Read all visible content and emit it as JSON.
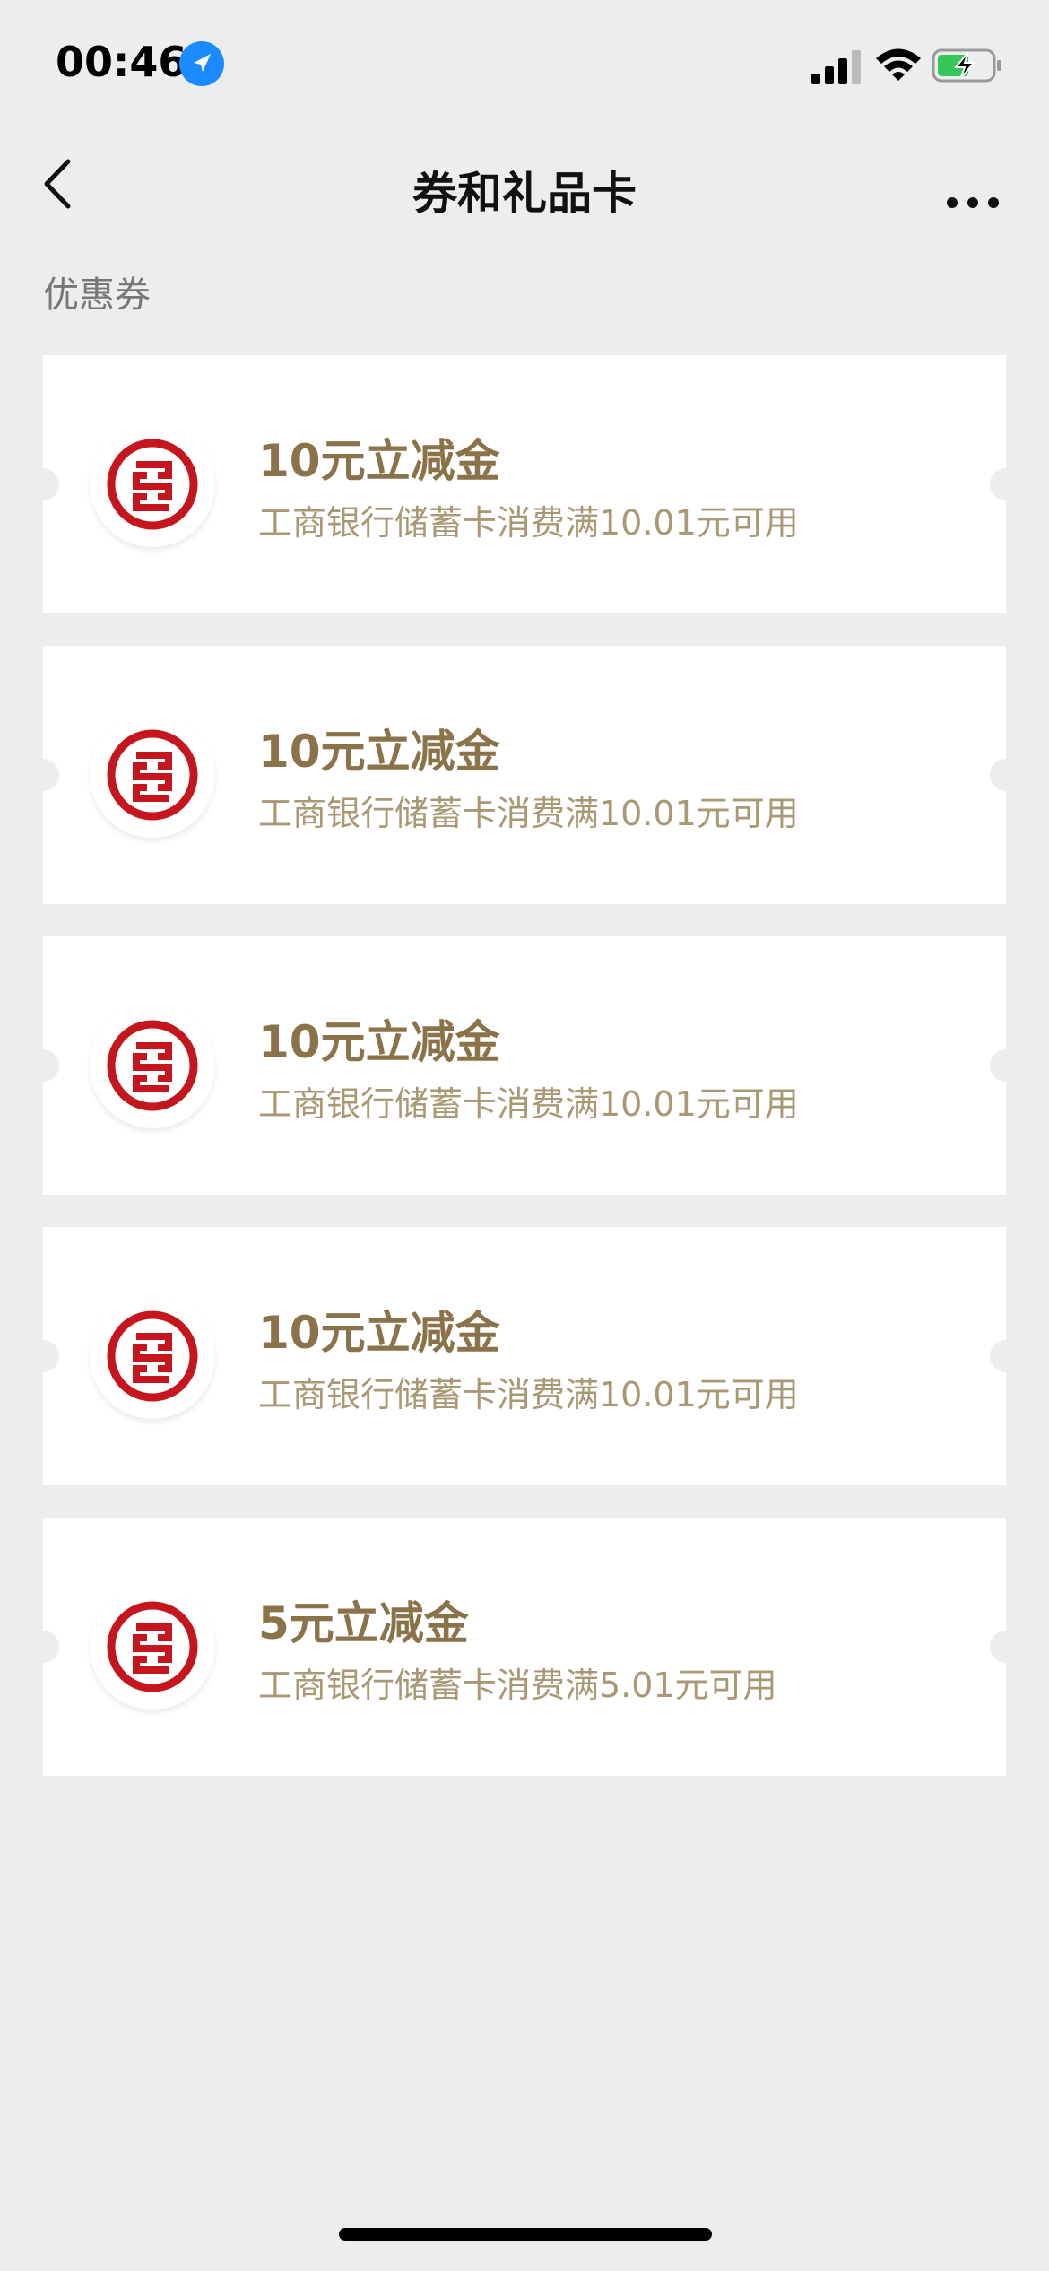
{
  "status_bar": {
    "time": "00:46"
  },
  "nav": {
    "title": "券和礼品卡"
  },
  "section": {
    "title": "优惠券"
  },
  "colors": {
    "background": "#ededed",
    "coupon_title": "#8b7349",
    "coupon_desc": "#a89874",
    "bank_logo_red": "#c4161c"
  },
  "coupons": [
    {
      "title": "10元立减金",
      "desc": "工商银行储蓄卡消费满10.01元可用",
      "logo": "icbc-logo-icon"
    },
    {
      "title": "10元立减金",
      "desc": "工商银行储蓄卡消费满10.01元可用",
      "logo": "icbc-logo-icon"
    },
    {
      "title": "10元立减金",
      "desc": "工商银行储蓄卡消费满10.01元可用",
      "logo": "icbc-logo-icon"
    },
    {
      "title": "10元立减金",
      "desc": "工商银行储蓄卡消费满10.01元可用",
      "logo": "icbc-logo-icon"
    },
    {
      "title": "5元立减金",
      "desc": "工商银行储蓄卡消费满5.01元可用",
      "logo": "icbc-logo-icon"
    }
  ]
}
